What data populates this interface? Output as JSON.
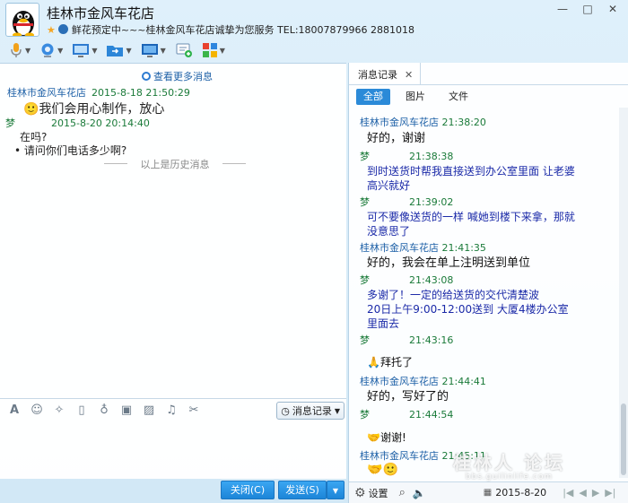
{
  "header": {
    "title": "桂林市金风车花店",
    "signature": "鲜花预定中~~~桂林金风车花店诚挚为您服务  TEL:18007879966   2881018"
  },
  "chat": {
    "view_more": "查看更多消息",
    "messages": [
      {
        "sender": "桂林市金风车花店",
        "time": "2015-8-18 21:50:29",
        "text": "我们会用心制作，放心"
      },
      {
        "sender": "梦",
        "time": "2015-8-20 20:14:40",
        "lines": [
          "在吗?",
          "请问你们电话多少啊?"
        ]
      }
    ],
    "history_divider": "以上是历史消息"
  },
  "input_toolbar": {
    "history_button": "消息记录"
  },
  "buttons": {
    "close": "关闭(C)",
    "send": "发送(S)"
  },
  "history_panel": {
    "tab_label": "消息记录",
    "filters": [
      "全部",
      "图片",
      "文件"
    ],
    "entries": [
      {
        "sender": "桂林市金风车花店",
        "time": "21:38:20",
        "text": "好的，谢谢"
      },
      {
        "sender": "梦",
        "time": "21:38:38",
        "text": "到时送货时帮我直接送到办公室里面 让老婆高兴就好",
        "lines": [
          "到时送货时帮我直接送到办公室里面 让老婆",
          "高兴就好"
        ]
      },
      {
        "sender": "梦",
        "time": "21:39:02",
        "text": "可不要像送货的一样 喊她到楼下来拿，那就没意思了",
        "lines": [
          "可不要像送货的一样 喊她到楼下来拿，那就",
          "没意思了"
        ]
      },
      {
        "sender": "桂林市金风车花店",
        "time": "21:41:35",
        "text": "好的，我会在单上注明送到单位"
      },
      {
        "sender": "梦",
        "time": "21:43:08",
        "text": "多谢了！一定的给送货的交代清楚波 20日上午9:00-12:00送到 大厦4楼办公室里面去",
        "lines": [
          "多谢了！一定的给送货的交代清楚波",
          "20日上午9:00-12:00送到        大厦4楼办公室",
          "里面去"
        ]
      },
      {
        "sender": "梦",
        "time": "21:43:16",
        "text": "拜托了"
      },
      {
        "sender": "桂林市金风车花店",
        "time": "21:44:41",
        "text": "好的，写好了的"
      },
      {
        "sender": "梦",
        "time": "21:44:54",
        "text": "谢谢!"
      },
      {
        "sender": "桂林市金风车花店",
        "time": "21:45:11",
        "text": ""
      }
    ],
    "settings_label": "设置",
    "date": "2015-8-20"
  },
  "watermark": {
    "text": "桂林人 论坛",
    "url": "bbs.guilinlife.com"
  }
}
